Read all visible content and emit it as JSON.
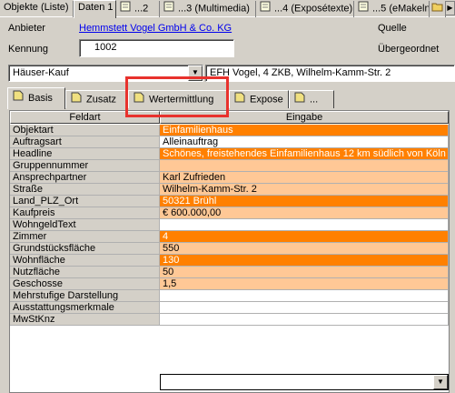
{
  "top_tabs": [
    {
      "label": "Objekte (Liste)"
    },
    {
      "label": "Daten 1"
    },
    {
      "label": "...2"
    },
    {
      "label": "...3 (Multimedia)"
    },
    {
      "label": "...4 (Exposétexte)"
    },
    {
      "label": "...5 (eMakeln 1)"
    }
  ],
  "form": {
    "anbieter_label": "Anbieter",
    "anbieter_value": "Hemmstett Vogel GmbH & Co. KG",
    "quelle_label": "Quelle",
    "kennung_label": "Kennung",
    "kennung_value": "1002",
    "uebergeordnet_label": "Übergeordnet",
    "category_value": "Häuser-Kauf",
    "title_value": "EFH Vogel, 4 ZKB, Wilhelm-Kamm-Str. 2"
  },
  "sub_tabs": [
    {
      "label": "Basis"
    },
    {
      "label": "Zusatz"
    },
    {
      "label": "Wertermittlung"
    },
    {
      "label": "Expose"
    },
    {
      "label": "..."
    }
  ],
  "grid": {
    "headers": [
      "Feldart",
      "Eingabe"
    ],
    "rows": [
      {
        "feld": "Objektart",
        "wert": "Einfamilienhaus",
        "style": "orange"
      },
      {
        "feld": "Auftragsart",
        "wert": "Alleinauftrag",
        "style": "white"
      },
      {
        "feld": "Headline",
        "wert": "Schönes, freistehendes Einfamilienhaus 12 km südlich von Köln",
        "style": "orange"
      },
      {
        "feld": "Gruppennummer",
        "wert": "",
        "style": "peach"
      },
      {
        "feld": "Ansprechpartner",
        "wert": "Karl Zufrieden",
        "style": "peach"
      },
      {
        "feld": "Straße",
        "wert": "Wilhelm-Kamm-Str. 2",
        "style": "peach"
      },
      {
        "feld": "Land_PLZ_Ort",
        "wert": "50321 Brühl",
        "style": "orange"
      },
      {
        "feld": "Kaufpreis",
        "wert": "€ 600.000,00",
        "style": "peach"
      },
      {
        "feld": "WohngeldText",
        "wert": "",
        "style": "white"
      },
      {
        "feld": "Zimmer",
        "wert": "4",
        "style": "orange"
      },
      {
        "feld": "Grundstücksfläche",
        "wert": "550",
        "style": "peach"
      },
      {
        "feld": "Wohnfläche",
        "wert": "130",
        "style": "orange"
      },
      {
        "feld": "Nutzfläche",
        "wert": "50",
        "style": "peach"
      },
      {
        "feld": "Geschosse",
        "wert": "1,5",
        "style": "peach"
      },
      {
        "feld": "Mehrstufige Darstellung",
        "wert": "",
        "style": "white"
      },
      {
        "feld": "Ausstattungsmerkmale",
        "wert": "",
        "style": "white"
      },
      {
        "feld": "MwStKnz",
        "wert": "",
        "style": "white"
      }
    ]
  },
  "colors": {
    "orange": "#ff8000",
    "peach": "#ffc896",
    "highlight": "#e8322d",
    "link": "#0000ee"
  },
  "icons": {
    "tab_page": "page-icon",
    "folder": "folder-icon"
  }
}
